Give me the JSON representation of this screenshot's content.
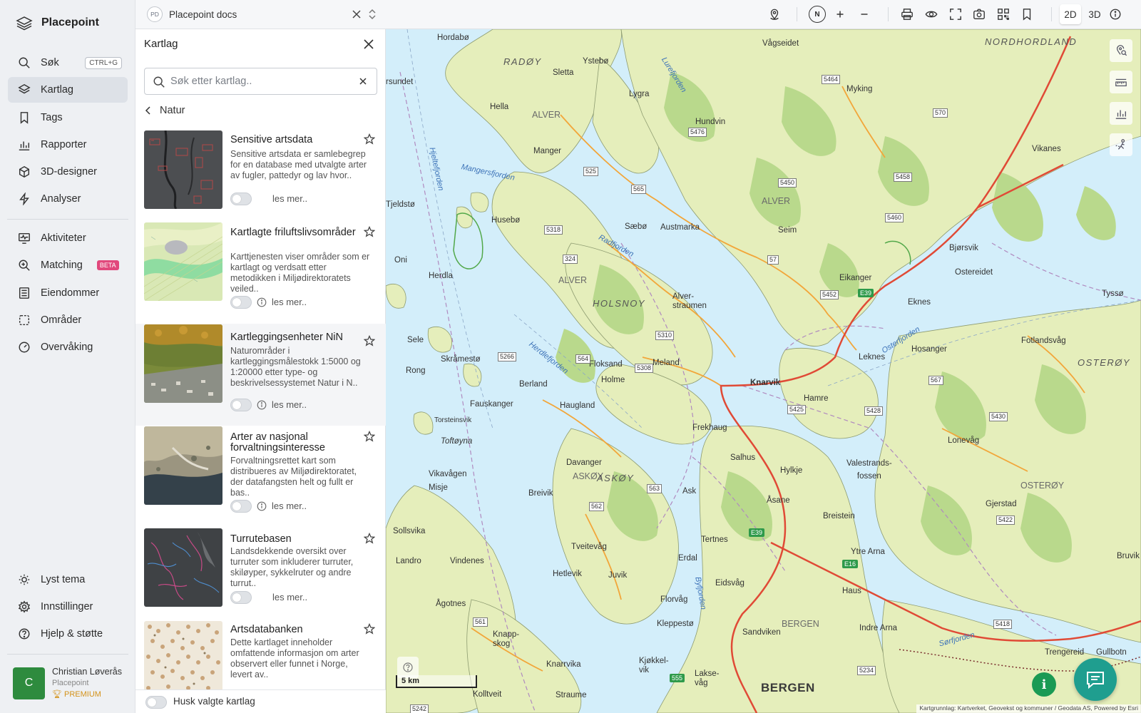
{
  "app": {
    "name": "Placepoint"
  },
  "nav": {
    "items": [
      {
        "label": "Søk",
        "shortcut": "CTRL+G"
      },
      {
        "label": "Kartlag"
      },
      {
        "label": "Tags"
      },
      {
        "label": "Rapporter"
      },
      {
        "label": "3D-designer"
      },
      {
        "label": "Analyser"
      },
      {
        "label": "Aktiviteter"
      },
      {
        "label": "Matching",
        "badge": "BETA"
      },
      {
        "label": "Eiendommer"
      },
      {
        "label": "Områder"
      },
      {
        "label": "Overvåking"
      }
    ],
    "bottom": [
      {
        "label": "Lyst tema"
      },
      {
        "label": "Innstillinger"
      },
      {
        "label": "Hjelp & støtte"
      }
    ],
    "user": {
      "initial": "C",
      "name": "Christian Løverås",
      "org": "Placepoint",
      "plan": "PREMIUM"
    }
  },
  "topbar": {
    "workspace_badge": "PD",
    "workspace_name": "Placepoint docs",
    "compass": "N",
    "view_2d": "2D",
    "view_3d": "3D",
    "active_view": "2D"
  },
  "panel": {
    "title": "Kartlag",
    "search_placeholder": "Søk etter kartlag..",
    "breadcrumb": "Natur",
    "read_more": "les mer..",
    "remember_label": "Husk valgte kartlag",
    "layers": [
      {
        "title": "Sensitive artsdata",
        "description": "Sensitive artsdata er samlebegrep for en database med utvalgte arter av fugler, pattedyr og lav hvor..",
        "enabled": false
      },
      {
        "title": "Kartlagte friluftslivsområder",
        "description": "Karttjenesten viser områder som er kartlagt og verdsatt etter metodikken i Miljødirektoratets veiled..",
        "enabled": false
      },
      {
        "title": "Kartleggingsenheter NiN",
        "description": "Naturområder i kartleggingsmålestokk 1:5000 og 1:20000 etter type- og beskrivelsessystemet Natur i N..",
        "enabled": false
      },
      {
        "title": "Arter av nasjonal forvaltningsinteresse",
        "description": "Forvaltningsrettet kart som distribueres av Miljødirektoratet, der datafangsten helt og fullt er bas..",
        "enabled": false
      },
      {
        "title": "Turrutebasen",
        "description": "Landsdekkende oversikt over turruter som inkluderer turruter, skiløyper, sykkelruter og andre turrut..",
        "enabled": false
      },
      {
        "title": "Artsdatabanken",
        "description": "Dette kartlaget inneholder omfattende informasjon om arter observert eller funnet i Norge, levert av..",
        "enabled": false
      }
    ]
  },
  "map": {
    "scale_label": "5 km",
    "attribution": "Kartgrunnlag: Kartverket, Geovekst og kommuner / Geodata AS, Powered by Esri",
    "labels": {
      "nordhordland": "NORDHORDLAND",
      "radoy": "RADØY",
      "alver1": "ALVER",
      "alver2": "ALVER",
      "alver3": "ALVER",
      "holsnoy": "HOLSNOY",
      "askoy": "ASKØY",
      "askoy2": "ASKØY",
      "osteroy": "OSTERØY",
      "osteroy2": "OSTERØY",
      "bergen_muni": "BERGEN",
      "bergen": "BERGEN",
      "knarvik": "Knarvik",
      "frekhaug": "Frekhaug",
      "hjeltefjorden": "Hjeltefjorden",
      "mangersfjorden": "Mangersfjorden",
      "radfjorden": "Radfjorden",
      "herdlefjorden": "Herdlefjorden",
      "osterfjorden": "Osterfjorden",
      "byfjorden": "Byfjorden",
      "lurefjorden": "Lurefjorden",
      "sorfjorden": "Sørfjorden",
      "hordabo": "Hordabø",
      "sletta": "Sletta",
      "ystebo": "Ystebø",
      "vagseidet": "Vågseidet",
      "manger": "Manger",
      "hella": "Hella",
      "lygra": "Lygra",
      "hundvin": "Hundvin",
      "myking": "Myking",
      "husebo": "Husebø",
      "saebo": "Sæbø",
      "austmarka": "Austmarka",
      "seim": "Seim",
      "eikanger": "Eikanger",
      "bjorsvik": "Bjørsvik",
      "ostereidet": "Ostereidet",
      "vikanes": "Vikanes",
      "tysso": "Tyssø",
      "herdla": "Herdla",
      "alverstraumen": "Alver-\nstraumen",
      "eknes": "Eknes",
      "lekne": "Leknes",
      "skramesto": "Skråmestø",
      "berland": "Berland",
      "floksand": "Floksand",
      "holme": "Holme",
      "meland": "Meland",
      "fauskanger": "Fauskanger",
      "hauglanf": "Haugland",
      "hamre": "Hamre",
      "hosanger": "Hosanger",
      "fotlandsvag": "Fotlandsvåg",
      "lonevag": "Lonevåg",
      "salhus": "Salhus",
      "hylkje": "Hylkje",
      "valestrand": "Valestrands-\nfossen",
      "gjerstad": "Gjerstad",
      "davanger": "Davanger",
      "breivik": "Breivik",
      "ask": "Ask",
      "asane": "Åsane",
      "breistein": "Breistein",
      "tertnes": "Tertnes",
      "ytrearna": "Ytre Arna",
      "haus": "Haus",
      "bruvik": "Bruvik",
      "tveitevag": "Tveitevåg",
      "hetlevik": "Hetlevik",
      "juvik": "Juvik",
      "erdal": "Erdal",
      "eidsvag": "Eidsvåg",
      "florvag": "Florvåg",
      "kleppesto": "Kleppestø",
      "sandviken": "Sandviken",
      "indrearna": "Indre Arna",
      "sollsvika": "Sollsvika",
      "landro": "Landro",
      "vindenes": "Vindenes",
      "agotnes": "Ågotnes",
      "knappskog": "Knapp-\nskog",
      "kjokkel": "Kjøkkel-\nvik",
      "knarrvika": "Knarrvika",
      "straume": "Straume",
      "laksevag": "Lakse-\nvåg",
      "kolltveit": "Kolltveit",
      "vikavagen": "Vikavågen",
      "misje": "Misje",
      "tofloy": "Toftøyna",
      "torsteinsvik": "Torsteinsvik",
      "rong": "Rong",
      "sele": "Sele",
      "oni": "Oni",
      "tjeldsto": "Tjeldstø",
      "rossundet": "rsundet",
      "fengereid": "Trengereid",
      "gullbotn": "Gullbotn"
    },
    "roads": [
      "5464",
      "5476",
      "565",
      "525",
      "5318",
      "324",
      "57",
      "5450",
      "5460",
      "5458",
      "570",
      "5452",
      "5310",
      "5266",
      "564",
      "5308",
      "5425",
      "5428",
      "5430",
      "567",
      "563",
      "562",
      "5422",
      "561",
      "5418",
      "5234",
      "5242"
    ],
    "eroads": [
      "E39",
      "E39",
      "E16",
      "555"
    ]
  }
}
